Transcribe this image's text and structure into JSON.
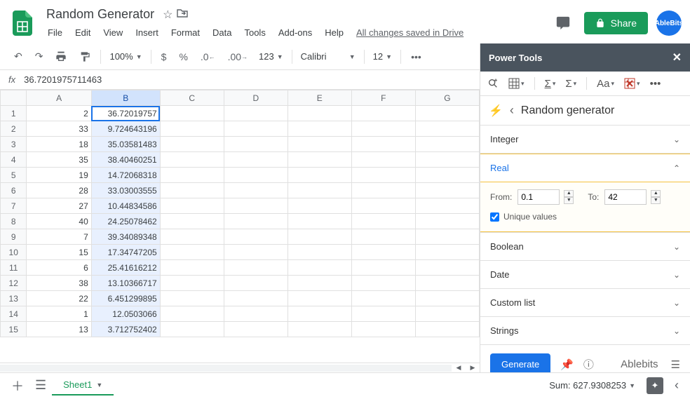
{
  "doc": {
    "title": "Random Generator",
    "save_status": "All changes saved in Drive"
  },
  "menus": [
    "File",
    "Edit",
    "View",
    "Insert",
    "Format",
    "Data",
    "Tools",
    "Add-ons",
    "Help"
  ],
  "share": {
    "label": "Share"
  },
  "avatar": {
    "label": "AbleBits"
  },
  "toolbar": {
    "zoom": "100%",
    "font": "Calibri",
    "font_size": "12",
    "currency": "$",
    "percent": "%",
    "dec_dec": ".0",
    "dec_inc": ".00",
    "more_fmt": "123",
    "more": "•••"
  },
  "formula": {
    "fx": "fx",
    "value": "36.7201975711463"
  },
  "columns": [
    "A",
    "B",
    "C",
    "D",
    "E",
    "F",
    "G"
  ],
  "rows": [
    {
      "n": 1,
      "a": "2",
      "b": "36.72019757"
    },
    {
      "n": 2,
      "a": "33",
      "b": "9.724643196"
    },
    {
      "n": 3,
      "a": "18",
      "b": "35.03581483"
    },
    {
      "n": 4,
      "a": "35",
      "b": "38.40460251"
    },
    {
      "n": 5,
      "a": "19",
      "b": "14.72068318"
    },
    {
      "n": 6,
      "a": "28",
      "b": "33.03003555"
    },
    {
      "n": 7,
      "a": "27",
      "b": "10.44834586"
    },
    {
      "n": 8,
      "a": "40",
      "b": "24.25078462"
    },
    {
      "n": 9,
      "a": "7",
      "b": "39.34089348"
    },
    {
      "n": 10,
      "a": "15",
      "b": "17.34747205"
    },
    {
      "n": 11,
      "a": "6",
      "b": "25.41616212"
    },
    {
      "n": 12,
      "a": "38",
      "b": "13.10366717"
    },
    {
      "n": 13,
      "a": "22",
      "b": "6.451299895"
    },
    {
      "n": 14,
      "a": "1",
      "b": "12.0503066"
    },
    {
      "n": 15,
      "a": "13",
      "b": "3.712752402"
    }
  ],
  "panel": {
    "title": "Power Tools",
    "page_title": "Random generator",
    "sections": {
      "integer": "Integer",
      "real": "Real",
      "boolean": "Boolean",
      "date": "Date",
      "custom": "Custom list",
      "strings": "Strings"
    },
    "real": {
      "from_label": "From:",
      "from_value": "0.1",
      "to_label": "To:",
      "to_value": "42",
      "unique_label": "Unique values"
    },
    "generate": "Generate",
    "brand": "Ablebits"
  },
  "tabs": {
    "sheet1": "Sheet1"
  },
  "status": {
    "sum": "Sum: 627.9308253"
  }
}
